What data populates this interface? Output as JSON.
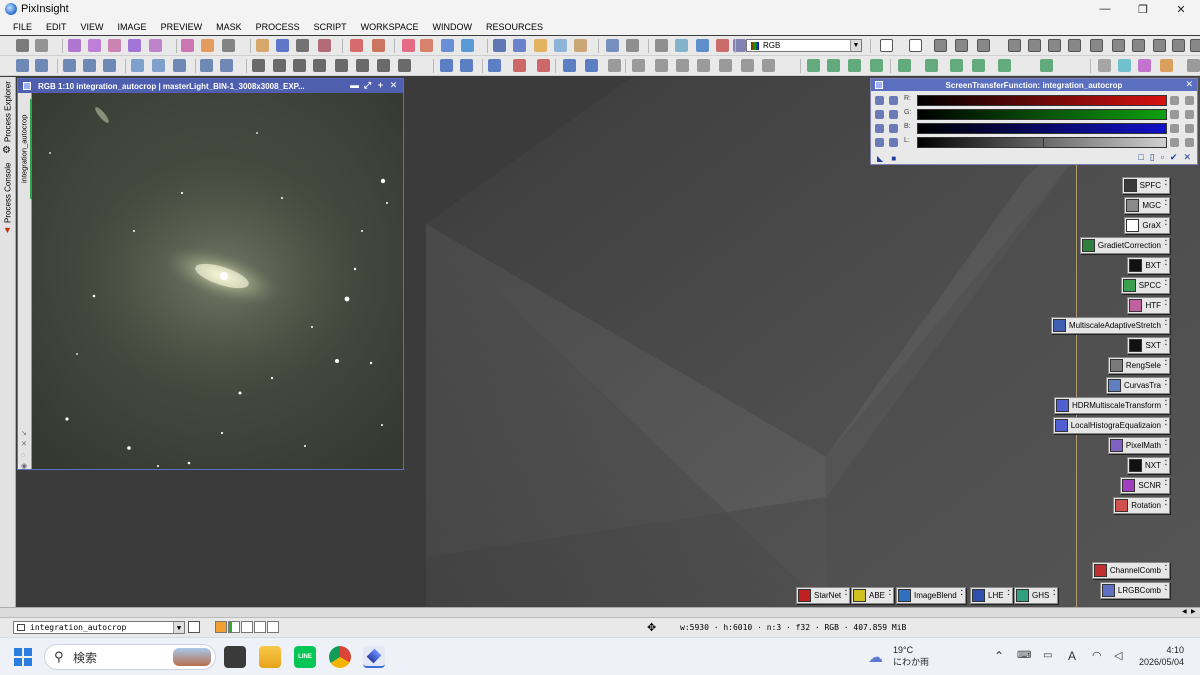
{
  "app": {
    "title": "PixInsight"
  },
  "window_controls": {
    "minimize": "—",
    "maximize": "❐",
    "close": "✕"
  },
  "menu": [
    "FILE",
    "EDIT",
    "VIEW",
    "IMAGE",
    "PREVIEW",
    "MASK",
    "PROCESS",
    "SCRIPT",
    "WORKSPACE",
    "WINDOW",
    "RESOURCES"
  ],
  "toolbar": {
    "channel_select": "RGB"
  },
  "side_tabs": {
    "process_explorer": "Process Explorer",
    "process_console": "Process Console"
  },
  "image_window": {
    "title": "RGB 1:10 integration_autocrop | masterLight_BIN-1_3008x3008_EXP...",
    "view_tab": "integration_autocrop",
    "controls": [
      "▬",
      "⤢",
      "+",
      "✕"
    ]
  },
  "stf": {
    "title": "ScreenTransferFunction: integration_autocrop",
    "channels": [
      {
        "label": "R:",
        "color": "#d81010"
      },
      {
        "label": "G:",
        "color": "#0fa010"
      },
      {
        "label": "B:",
        "color": "#1010c8"
      },
      {
        "label": "L:",
        "color": "#8a8a8a"
      }
    ]
  },
  "process_icons": [
    {
      "label": "SPFC",
      "icon": "#3a3a3a"
    },
    {
      "label": "MGC",
      "icon": "#8a8a8a"
    },
    {
      "label": "GraX",
      "icon": "#ffffff"
    },
    {
      "label": "GradietCorrection",
      "icon": "#2f7f3f"
    },
    {
      "label": "BXT",
      "icon": "#111111"
    },
    {
      "label": "SPCC",
      "icon": "#3b9f4f"
    },
    {
      "label": "HTF",
      "icon": "#c060a0"
    },
    {
      "label": "MultiscaleAdaptiveStretch",
      "icon": "#3f5fb0"
    },
    {
      "label": "SXT",
      "icon": "#111111"
    },
    {
      "label": "RengSele",
      "icon": "#7a7a7a"
    },
    {
      "label": "CurvasTra",
      "icon": "#5f7fc0"
    },
    {
      "label": "HDRMultiscaleTransform",
      "icon": "#5060d0"
    },
    {
      "label": "LocalHistograEqualizaion",
      "icon": "#5060d0"
    },
    {
      "label": "PixelMath",
      "icon": "#8060c0"
    },
    {
      "label": "NXT",
      "icon": "#111111"
    },
    {
      "label": "SCNR",
      "icon": "#a040c0"
    },
    {
      "label": "Rotation",
      "icon": "#d05050"
    },
    {
      "label": "ChannelComb",
      "icon": "#c03030"
    },
    {
      "label": "LRGBComb",
      "icon": "#6070c0"
    }
  ],
  "bottom_icons": [
    {
      "label": "StarNet",
      "icon": "#c02020"
    },
    {
      "label": "ABE",
      "icon": "#d0c020"
    },
    {
      "label": "ImageBlend",
      "icon": "#3070c0"
    },
    {
      "label": "LHE",
      "icon": "#3050b0"
    },
    {
      "label": "GHS",
      "icon": "#30a080"
    }
  ],
  "status": {
    "view_name": "integration_autocrop",
    "info": "w:5930 · h:6010 · n:3 · f32 · RGB · 407.859 MiB"
  },
  "taskbar": {
    "search_placeholder": "検索",
    "weather_temp": "19°C",
    "weather_desc": "にわか雨",
    "time": "4:10",
    "date": "2026/05/04"
  }
}
